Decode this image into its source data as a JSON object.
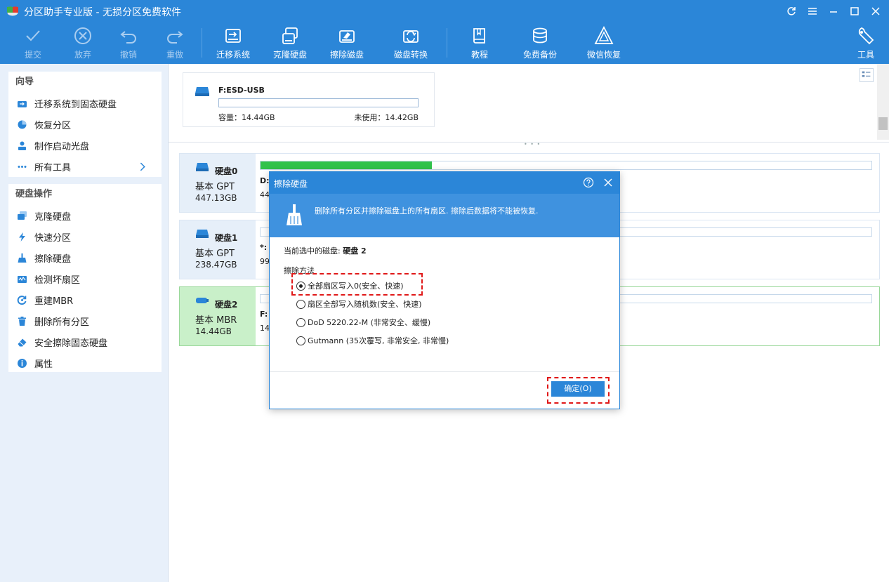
{
  "window": {
    "title": "分区助手专业版 - 无损分区免费软件"
  },
  "toolbar": {
    "commit": "提交",
    "discard": "放弃",
    "undo": "撤销",
    "redo": "重做",
    "migrate": "迁移系统",
    "clone": "克隆硬盘",
    "wipe": "擦除磁盘",
    "convert": "磁盘转换",
    "tutorial": "教程",
    "backup": "免费备份",
    "wechat": "微信恢复",
    "tools": "工具"
  },
  "sidebar": {
    "wizard_title": "向导",
    "wizard_items": [
      {
        "label": "迁移系统到固态硬盘",
        "icon": "migrate-icon"
      },
      {
        "label": "恢复分区",
        "icon": "pie-chart-icon"
      },
      {
        "label": "制作启动光盘",
        "icon": "user-disk-icon"
      },
      {
        "label": "所有工具",
        "icon": "more-dots-icon"
      }
    ],
    "disk_ops_title": "硬盘操作",
    "disk_ops_items": [
      {
        "label": "克隆硬盘",
        "icon": "clone-disk-icon"
      },
      {
        "label": "快速分区",
        "icon": "lightning-icon"
      },
      {
        "label": "擦除硬盘",
        "icon": "broom-icon"
      },
      {
        "label": "检测坏扇区",
        "icon": "sector-check-icon"
      },
      {
        "label": "重建MBR",
        "icon": "rebuild-icon"
      },
      {
        "label": "删除所有分区",
        "icon": "trash-icon"
      },
      {
        "label": "安全擦除固态硬盘",
        "icon": "eraser-icon"
      },
      {
        "label": "属性",
        "icon": "info-icon"
      }
    ]
  },
  "usb": {
    "name": "F:ESD-USB",
    "capacity": "容量：14.44GB",
    "unused": "未使用：14.42GB"
  },
  "disks": [
    {
      "title": "硬盘0",
      "type": "基本 GPT",
      "size": "447.13GB",
      "part_label": "D:",
      "part_size": "44",
      "used_fraction": 0.28
    },
    {
      "title": "硬盘1",
      "type": "基本 GPT",
      "size": "238.47GB",
      "part_label": "*:",
      "part_size": "99",
      "used_fraction": 0.0
    },
    {
      "title": "硬盘2",
      "type": "基本 MBR",
      "size": "14.44GB",
      "part_label": "F:",
      "part_size": "14",
      "used_fraction": 0.0
    }
  ],
  "dialog": {
    "title": "擦除硬盘",
    "banner": "删除所有分区并擦除磁盘上的所有扇区. 擦除后数据将不能被恢复.",
    "current_prefix": "当前选中的磁盘: ",
    "current_disk": "硬盘 2",
    "method_label": "擦除方法",
    "options": [
      {
        "label": "全部扇区写入0(安全、快速)",
        "selected": true
      },
      {
        "label": "扇区全部写入随机数(安全、快速)",
        "selected": false
      },
      {
        "label": "DoD 5220.22-M (非常安全、缓慢)",
        "selected": false
      },
      {
        "label": "Gutmann (35次覆写, 非常安全, 非常慢)",
        "selected": false
      }
    ],
    "ok": "确定(O)"
  },
  "colors": {
    "accent": "#2b86d8",
    "used_bar": "#31c24b",
    "selected_row": "#c9f0c9",
    "highlight": "#e01818"
  }
}
